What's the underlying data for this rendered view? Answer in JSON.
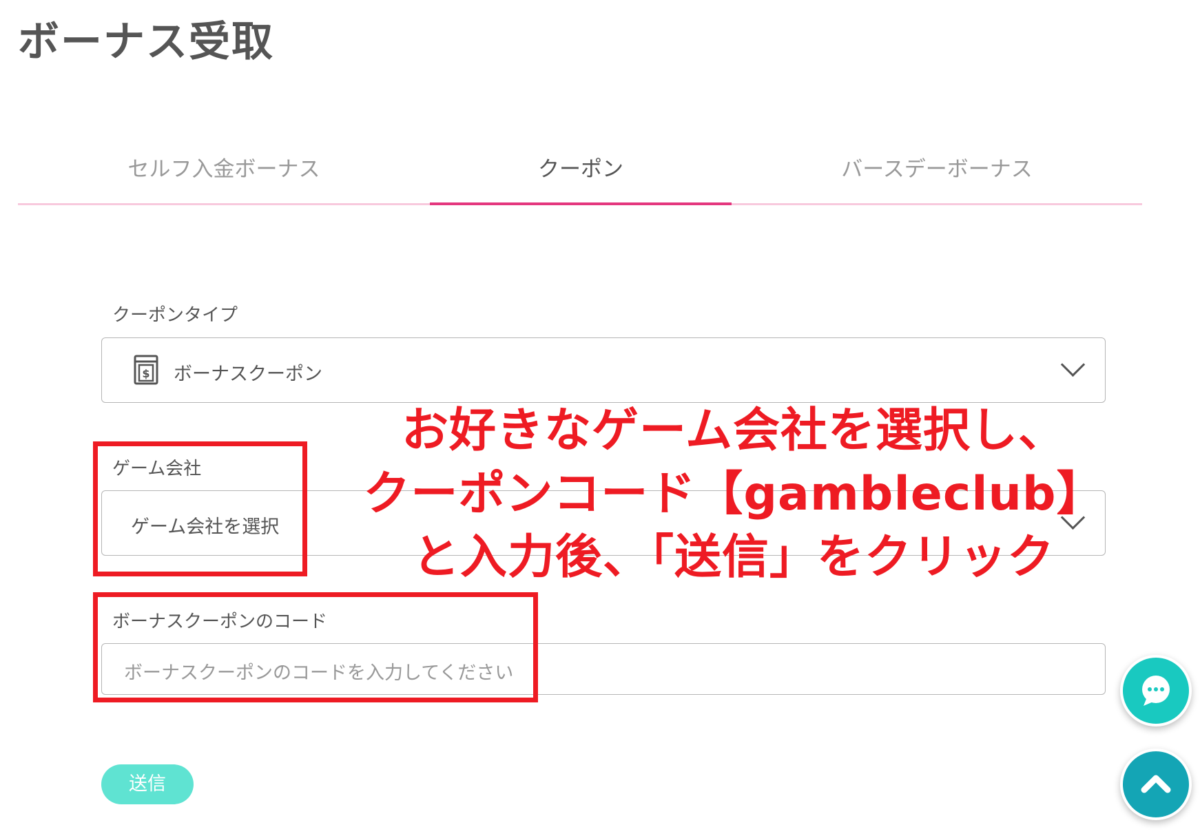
{
  "page": {
    "title": "ボーナス受取"
  },
  "tabs": [
    {
      "label": "セルフ入金ボーナス",
      "active": false
    },
    {
      "label": "クーポン",
      "active": true
    },
    {
      "label": "バースデーボーナス",
      "active": false
    }
  ],
  "form": {
    "coupon_type": {
      "label": "クーポンタイプ",
      "value": "ボーナスクーポン",
      "icon": "coupon-dollar-icon"
    },
    "game_company": {
      "label": "ゲーム会社",
      "value": "ゲーム会社を選択"
    },
    "coupon_code": {
      "label": "ボーナスクーポンのコード",
      "placeholder": "ボーナスクーポンのコードを入力してください"
    },
    "submit_label": "送信"
  },
  "annotation": {
    "line1": "お好きなゲーム会社を選択し、",
    "line2": "クーポンコード【gambleclub】",
    "line3": "と入力後、「送信」をクリック"
  },
  "floating": {
    "chat_icon": "chat-bubble-icon",
    "top_icon": "chevron-up-icon"
  },
  "colors": {
    "accent_pink": "#e4377e",
    "tab_line": "#f8c9dd",
    "submit": "#5fe3d2",
    "annotation_red": "#ee1b23",
    "chat_fab": "#19c9c0",
    "top_fab": "#14a5b5"
  }
}
